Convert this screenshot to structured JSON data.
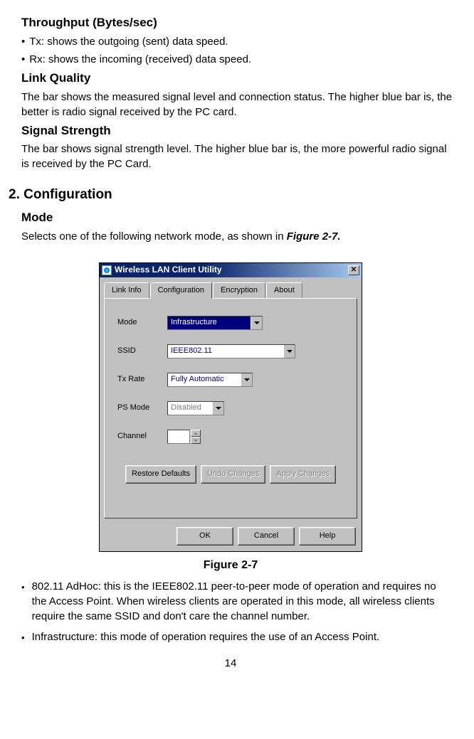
{
  "sections": {
    "throughput_heading": "Throughput (Bytes/sec)",
    "tx_text": "Tx: shows the outgoing (sent) data speed.",
    "rx_text": "Rx: shows the incoming (received) data speed.",
    "link_quality_heading": "Link Quality",
    "link_quality_text": "The bar shows the measured signal level and connection status. The higher blue bar is, the better is radio signal received by the PC card.",
    "signal_strength_heading": "Signal Strength",
    "signal_strength_text": "The bar shows signal strength level. The higher blue bar is, the more powerful radio signal is received by the PC Card.",
    "config_heading": "2. Configuration",
    "mode_heading": "Mode",
    "mode_intro_prefix": "Selects one of the following network mode, as shown in ",
    "mode_intro_figref": "Figure 2-7",
    "mode_intro_suffix": "."
  },
  "dialog": {
    "title": "Wireless LAN Client Utility",
    "tabs": [
      "Link Info",
      "Configuration",
      "Encryption",
      "About"
    ],
    "active_tab_index": 1,
    "fields": {
      "mode_label": "Mode",
      "mode_value": "Infrastructure",
      "ssid_label": "SSID",
      "ssid_value": "IEEE802.11",
      "txrate_label": "Tx Rate",
      "txrate_value": "Fully Automatic",
      "psmode_label": "PS Mode",
      "psmode_value": "Disabled",
      "channel_label": "Channel"
    },
    "buttons": {
      "restore": "Restore Defaults",
      "undo": "Undo Changes",
      "apply": "Apply Changes",
      "ok": "OK",
      "cancel": "Cancel",
      "help": "Help"
    }
  },
  "figure_caption": "Figure 2-7",
  "list": {
    "adhoc": "802.11 AdHoc: this is the IEEE802.11 peer-to-peer mode of operation and requires no the Access Point. When wireless clients are operated in this mode, all wireless clients require the same SSID and don't care the channel number.",
    "infra": "Infrastructure: this mode of operation requires the use of an Access Point."
  },
  "page_number": "14"
}
